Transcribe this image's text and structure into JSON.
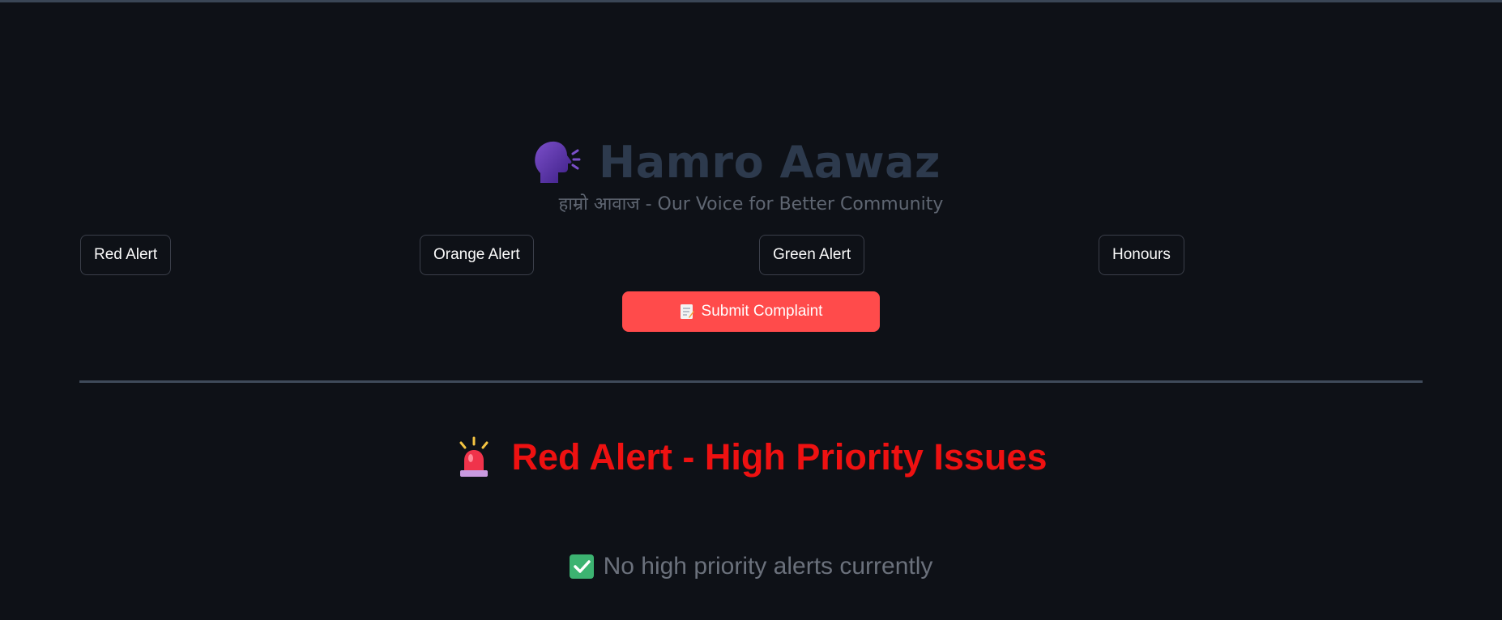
{
  "header": {
    "title": "Hamro Aawaz",
    "title_icon": "speaking-head-icon",
    "subtitle": "हाम्रो आवाज - Our Voice for Better Community"
  },
  "nav": {
    "buttons": [
      {
        "label": "Red Alert"
      },
      {
        "label": "Orange Alert"
      },
      {
        "label": "Green Alert"
      },
      {
        "label": "Honours"
      }
    ]
  },
  "submit": {
    "label": "Submit Complaint",
    "icon": "memo-icon",
    "color": "#ff4b4b"
  },
  "section": {
    "heading": "Red Alert - High Priority Issues",
    "heading_icon": "police-siren-icon",
    "heading_color": "#ee1111",
    "status_text": "No high priority alerts currently",
    "status_icon": "check-mark-icon"
  },
  "colors": {
    "background": "#0e1117",
    "title": "#2d3a4d",
    "accent": "#ff4b4b"
  }
}
